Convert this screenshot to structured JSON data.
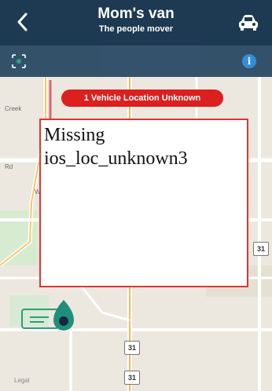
{
  "header": {
    "title": "Mom's van",
    "subtitle": "The people mover"
  },
  "banner": {
    "text": "1 Vehicle Location Unknown"
  },
  "placeholder": {
    "text": "Missing ios_loc_unknown3"
  },
  "map": {
    "labels": [
      "Legal",
      "Rd",
      "W",
      "Creek"
    ],
    "route_shields": [
      "31",
      "31",
      "31"
    ]
  },
  "colors": {
    "header_bg": "#1d3a52",
    "toolbar_bg": "#2c4c66",
    "alert_red": "#dc1f1f",
    "info_blue": "#2f8ad6",
    "vehicle_marker": "#1f8f7a"
  },
  "icons": {
    "back": "chevron-left",
    "vehicle": "car",
    "recenter": "crosshair",
    "info": "info-circle",
    "marker": "location-pin"
  }
}
